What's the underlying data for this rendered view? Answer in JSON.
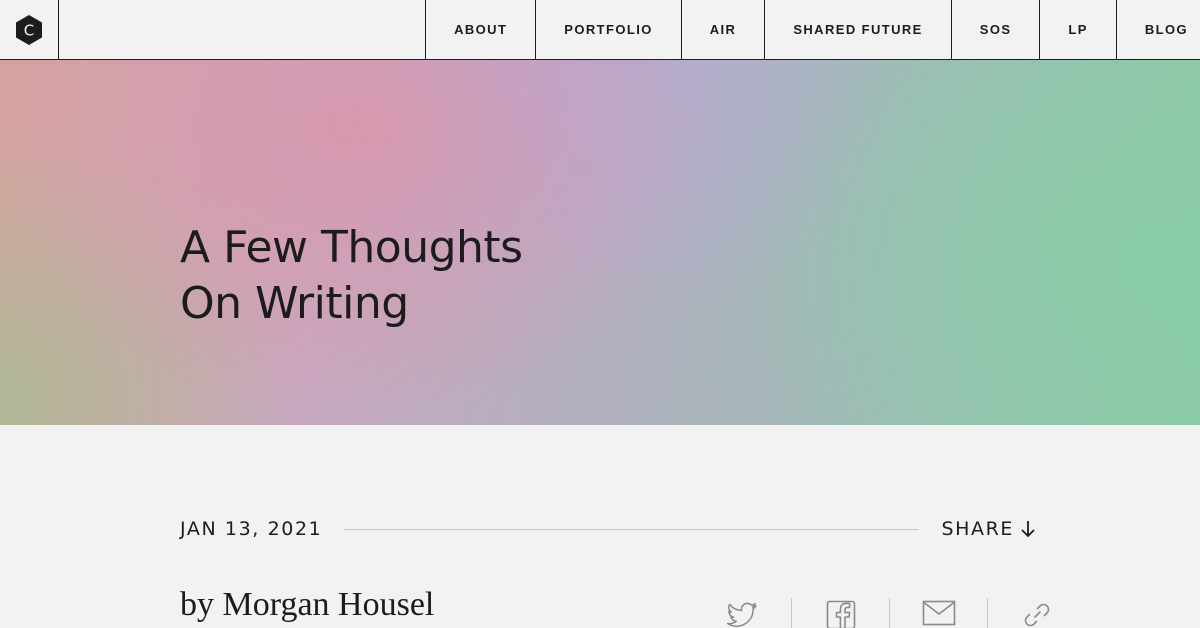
{
  "header": {
    "logo_letter": "C",
    "nav": [
      {
        "label": "ABOUT"
      },
      {
        "label": "PORTFOLIO"
      },
      {
        "label": "AIR"
      },
      {
        "label": "SHARED FUTURE"
      },
      {
        "label": "SOS"
      },
      {
        "label": "LP"
      },
      {
        "label": "BLOG"
      }
    ]
  },
  "hero": {
    "title_line1": "A Few Thoughts",
    "title_line2": "On Writing"
  },
  "article": {
    "date": "JAN 13, 2021",
    "share_label": "SHARE",
    "byline": "by Morgan Housel",
    "share_icons": [
      "twitter-icon",
      "facebook-icon",
      "email-icon",
      "link-icon"
    ]
  },
  "colors": {
    "text": "#1c1c1c",
    "background": "#f2f2f2",
    "hero_pink": "#d99aaa",
    "hero_lavender": "#b4aad4",
    "hero_green": "#8ccba8"
  }
}
